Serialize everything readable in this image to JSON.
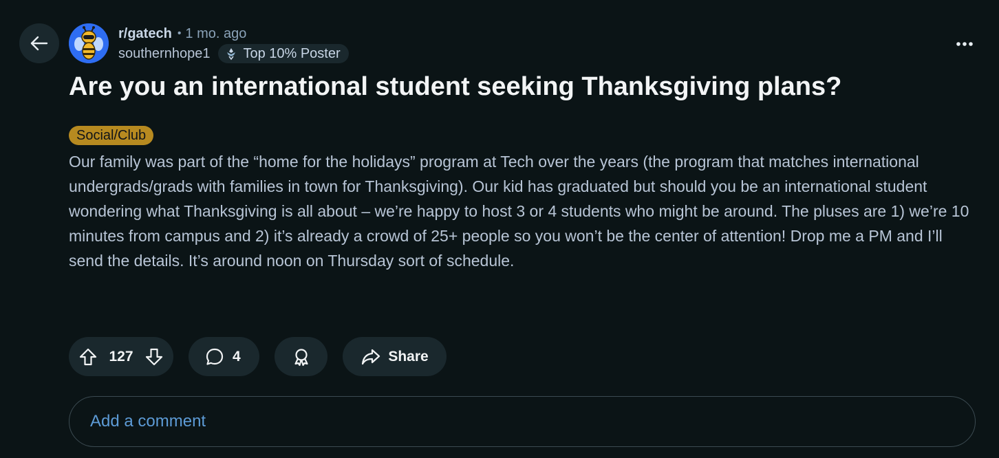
{
  "header": {
    "back_icon": "arrow-left-icon",
    "subreddit": "r/gatech",
    "separator": "•",
    "time_ago": "1 mo. ago",
    "author": "southernhope1",
    "author_badge": "Top 10% Poster",
    "more_icon": "more-horizontal-icon"
  },
  "post": {
    "title": "Are you an international student seeking Thanksgiving plans?",
    "flair": "Social/Club",
    "flair_color": "#b78a20",
    "body": "Our family was part of the “home for the holidays” program at Tech over the years (the program that matches international undergrads/grads with families in town for Thanksgiving). Our kid has graduated but should you be an international student wondering what Thanksgiving is all about – we’re happy to host 3 or 4 students who might be around. The pluses are 1) we’re 10 minutes from campus and 2) it’s already a crowd of 25+ people so you won’t be the center of attention! Drop me a PM and I’ll send the details. It’s around noon on Thursday sort of schedule."
  },
  "actions": {
    "score": "127",
    "comment_count": "4",
    "share_label": "Share"
  },
  "comment_input": {
    "placeholder": "Add a comment"
  },
  "colors": {
    "background": "#0b1416",
    "pill_background": "#1a282d",
    "accent_link": "#5d9bd6",
    "avatar_background": "#2e6df2"
  }
}
